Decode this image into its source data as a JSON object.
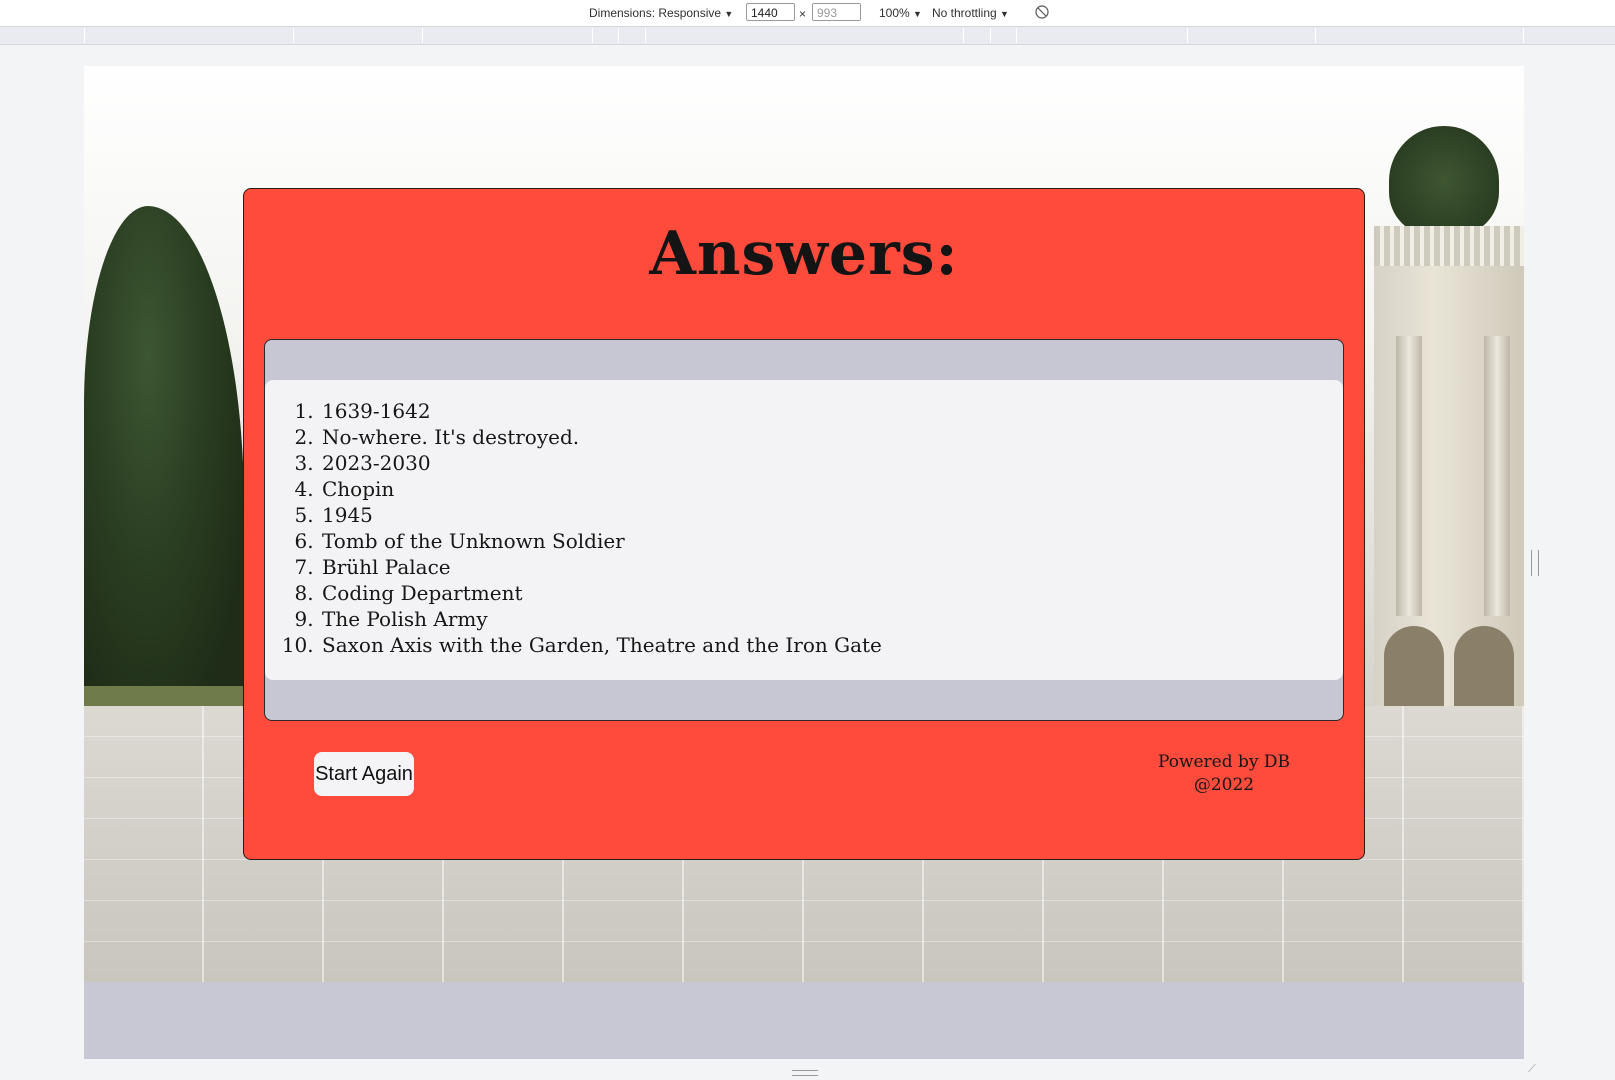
{
  "devtools": {
    "dimensions_label": "Dimensions: Responsive",
    "width_value": "1440",
    "height_placeholder": "993",
    "times_sign": "×",
    "zoom_label": "100%",
    "throttling_label": "No throttling",
    "dropdown_arrow": "▼"
  },
  "page": {
    "title": "Answers:",
    "answers": [
      "1639-1642",
      "No-where. It's destroyed.",
      "2023-2030",
      "Chopin",
      "1945",
      "Tomb of the Unknown Soldier",
      "Brühl Palace",
      "Coding Department",
      "The Polish Army",
      "Saxon Axis with the Garden, Theatre and the Iron Gate"
    ],
    "start_button_label": "Start Again",
    "footer_line1": "Powered by DB",
    "footer_line2": "@2022"
  },
  "colors": {
    "card_background": "#ff4b3c",
    "panel_background": "#c6c7d3",
    "list_background": "#f3f3f5",
    "viewport_footer": "#c7c8d4"
  },
  "icons": {
    "rotate": "rotate-icon"
  }
}
